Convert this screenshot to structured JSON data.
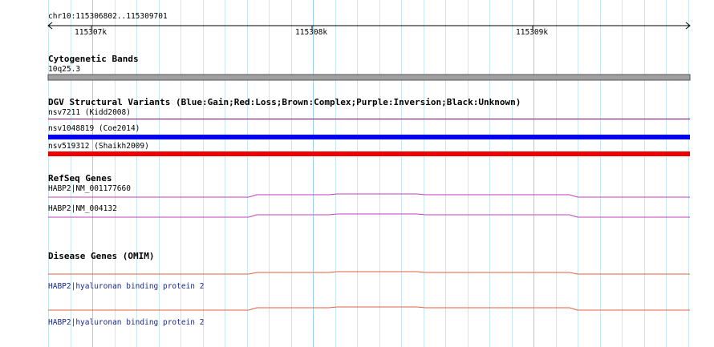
{
  "ruler": {
    "location": "chr10:115306802..115309701",
    "ticks": [
      "115307k",
      "115308k",
      "115309k"
    ]
  },
  "tracks": {
    "cytogenetic": {
      "title": "Cytogenetic Bands",
      "band": "10q25.3",
      "color": "#a0a0a0"
    },
    "dgv": {
      "title": "DGV Structural Variants (Blue:Gain;Red:Loss;Brown:Complex;Purple:Inversion;Black:Unknown)",
      "items": [
        {
          "label": "nsv7211 (Kidd2008)",
          "color": "#800080",
          "type": "inversion"
        },
        {
          "label": "nsv1048819 (Coe2014)",
          "color": "#0000ee",
          "type": "gain"
        },
        {
          "label": "nsv519312 (Shaikh2009)",
          "color": "#ee0000",
          "type": "loss"
        }
      ]
    },
    "refseq": {
      "title": "RefSeq Genes",
      "items": [
        {
          "label": "HABP2|NM_001177660",
          "color": "#c040c0"
        },
        {
          "label": "HABP2|NM_004132",
          "color": "#c040c0"
        }
      ]
    },
    "disease": {
      "title": "Disease Genes (OMIM)",
      "items": [
        {
          "label": "HABP2|hyaluronan binding protein 2",
          "color": "#e06040"
        },
        {
          "label": "HABP2|hyaluronan binding protein 2",
          "color": "#e06040"
        }
      ]
    }
  },
  "colors": {
    "grid_minor": "#c8e8f0",
    "grid_major": "#a0d0e8"
  }
}
